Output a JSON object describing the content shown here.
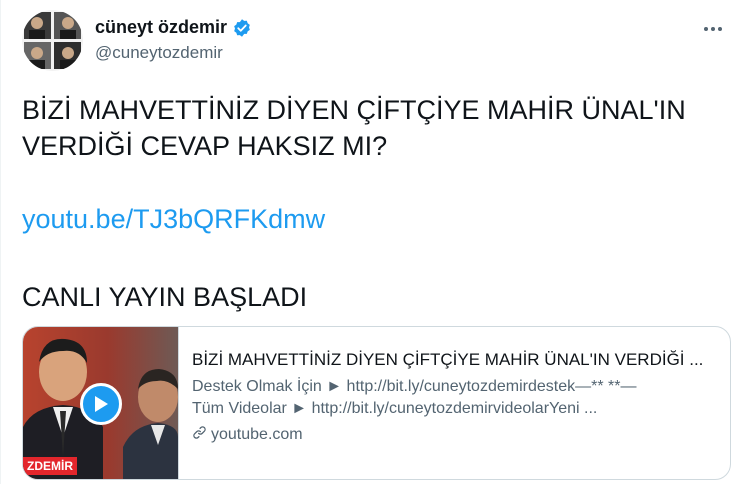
{
  "author": {
    "display_name": "cüneyt özdemir",
    "handle": "@cuneytozdemir",
    "verified": true,
    "avatar_icon": "avatar-photo-grid"
  },
  "tweet": {
    "text_line1": "BİZİ MAHVETTİNİZ DİYEN ÇİFTÇİYE MAHİR ÜNAL'IN",
    "text_line2": "VERDİĞİ CEVAP HAKSIZ MI?",
    "link": "youtu.be/TJ3bQRFKdmw",
    "status": "CANLI YAYIN BAŞLADI"
  },
  "card": {
    "title": "BİZİ MAHVETTİNİZ DİYEN ÇİFTÇİYE MAHİR ÜNAL'IN VERDİĞİ ...",
    "desc_line1": "Destek Olmak İçin ► http://bit.ly/cuneytozdemirdestek—** **—",
    "desc_line2": "Tüm Videolar ► http://bit.ly/cuneytozdemirvideolarYeni ...",
    "domain": "youtube.com",
    "brand_label": "ZDEMİR"
  },
  "colors": {
    "accent": "#1d9bf0",
    "text": "#0f1419",
    "secondary": "#536471",
    "brand": "#e3262c"
  }
}
